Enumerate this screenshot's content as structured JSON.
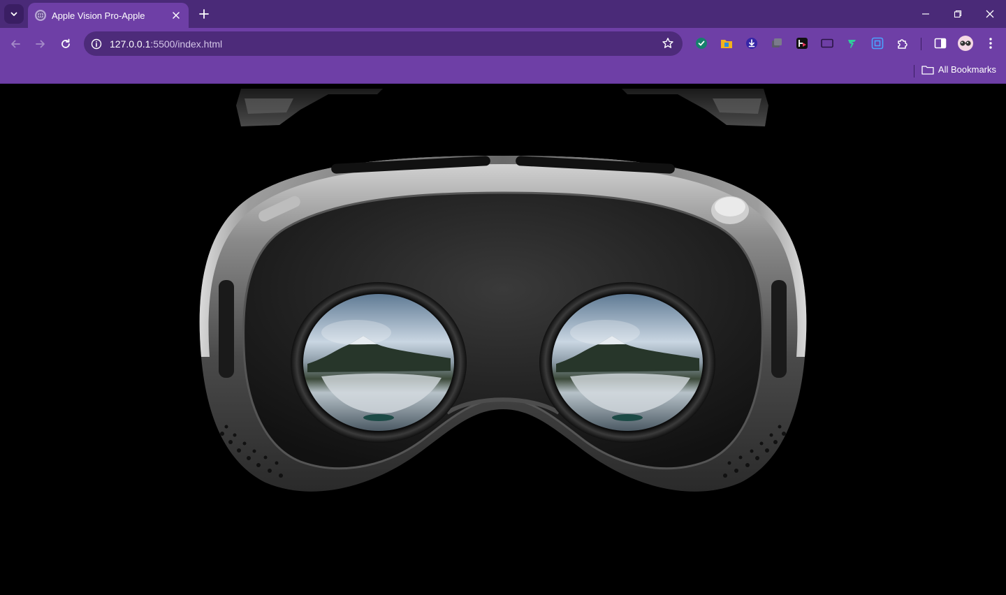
{
  "browser": {
    "tab_title": "Apple Vision Pro-Apple",
    "url_host": "127.0.0.1",
    "url_path": ":5500/index.html",
    "bookmarks_label": "All Bookmarks",
    "theme": {
      "tabstrip": "#4a2a78",
      "toolbar": "#6e3fa6",
      "omnibox": "#4d2b7a"
    },
    "extensions": [
      "shield-extension-icon",
      "folder-extension-icon",
      "download-extension-icon",
      "stack-extension-icon",
      "media-extension-icon",
      "window-extension-icon",
      "runner-extension-icon",
      "capture-extension-icon",
      "puzzle-icon",
      "side-panel-icon",
      "profile-avatar",
      "kebab-menu-icon"
    ]
  },
  "page": {
    "background": "#000000",
    "hero_subject": "headset-image"
  }
}
